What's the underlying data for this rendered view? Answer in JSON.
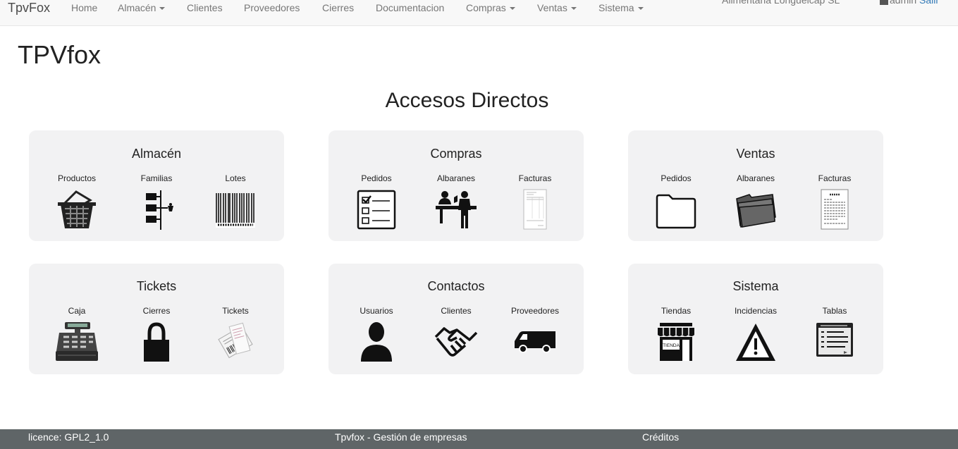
{
  "navbar": {
    "brand": "TpvFox",
    "items": [
      {
        "label": "Home",
        "dropdown": false
      },
      {
        "label": "Almacén",
        "dropdown": true
      },
      {
        "label": "Clientes",
        "dropdown": false
      },
      {
        "label": "Proveedores",
        "dropdown": false
      },
      {
        "label": "Cierres",
        "dropdown": false
      },
      {
        "label": "Documentacion",
        "dropdown": false
      },
      {
        "label": "Compras",
        "dropdown": true
      },
      {
        "label": "Ventas",
        "dropdown": true
      },
      {
        "label": "Sistema",
        "dropdown": true
      }
    ],
    "store_name": "Alimentaria Longueicap SL",
    "user": "admin",
    "logout": "Salir"
  },
  "page_title": "TPVfox",
  "section_title": "Accesos Directos",
  "cards": [
    {
      "title": "Almacén",
      "items": [
        {
          "label": "Productos",
          "icon": "basket-icon"
        },
        {
          "label": "Familias",
          "icon": "tree-icon"
        },
        {
          "label": "Lotes",
          "icon": "barcode-icon"
        }
      ]
    },
    {
      "title": "Compras",
      "items": [
        {
          "label": "Pedidos",
          "icon": "checklist-icon"
        },
        {
          "label": "Albaranes",
          "icon": "counter-icon"
        },
        {
          "label": "Facturas",
          "icon": "invoice-icon"
        }
      ]
    },
    {
      "title": "Ventas",
      "items": [
        {
          "label": "Pedidos",
          "icon": "folder-icon"
        },
        {
          "label": "Albaranes",
          "icon": "folders-icon"
        },
        {
          "label": "Facturas",
          "icon": "document-icon"
        }
      ]
    },
    {
      "title": "Tickets",
      "items": [
        {
          "label": "Caja",
          "icon": "cash-register-icon"
        },
        {
          "label": "Cierres",
          "icon": "lock-icon"
        },
        {
          "label": "Tickets",
          "icon": "receipt-icon"
        }
      ]
    },
    {
      "title": "Contactos",
      "items": [
        {
          "label": "Usuarios",
          "icon": "user-icon"
        },
        {
          "label": "Clientes",
          "icon": "handshake-icon"
        },
        {
          "label": "Proveedores",
          "icon": "van-icon"
        }
      ]
    },
    {
      "title": "Sistema",
      "items": [
        {
          "label": "Tiendas",
          "icon": "store-icon"
        },
        {
          "label": "Incidencias",
          "icon": "warning-icon"
        },
        {
          "label": "Tablas",
          "icon": "table-window-icon"
        }
      ]
    }
  ],
  "store_sign": "TIENDA",
  "footer": {
    "licence": "licence: GPL2_1.0",
    "tagline": "Tpvfox - Gestión de empresas",
    "credits": "Créditos"
  }
}
